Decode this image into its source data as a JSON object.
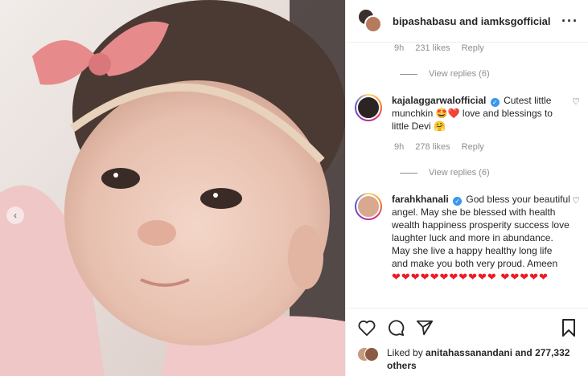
{
  "post": {
    "header_title": "bipashabasu and iamksgofficial",
    "photo_alt": "baby photo"
  },
  "comments": [
    {
      "partial": true,
      "time": "9h",
      "likes": "231 likes",
      "reply": "Reply",
      "view_replies": "View replies (6)"
    },
    {
      "user": "kajalaggarwalofficial",
      "text": "Cutest little munchkin 🤩❤️ love and blessings to little Devi 🤗",
      "time": "9h",
      "likes": "278 likes",
      "reply": "Reply",
      "view_replies": "View replies (6)"
    },
    {
      "user": "farahkhanali",
      "text": "God bless your beautiful angel. May she be blessed with health wealth happiness prosperity success love laughter luck and more in abundance. May she live a happy healthy long life and make you both very proud. Ameen",
      "hearts": "❤❤❤❤❤❤❤❤❤❤❤ ❤❤❤❤❤"
    }
  ],
  "likes_line": {
    "prefix": "Liked by ",
    "user": "anitahassanandani",
    "suffix": " and 277,332 others"
  },
  "icons": {
    "more": "more-icon",
    "like": "heart-icon",
    "comment": "comment-icon",
    "share": "share-icon",
    "save": "bookmark-icon"
  },
  "colors": {
    "verified": "#3897f0",
    "heart_emoji": "#ed1c24",
    "muted": "#8e8e8e"
  }
}
